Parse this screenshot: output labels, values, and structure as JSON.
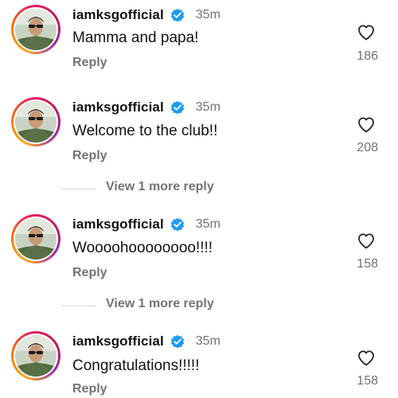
{
  "comments": [
    {
      "username": "iamksgofficial",
      "time": "35m",
      "text": "Mamma and papa!",
      "reply_label": "Reply",
      "likes": "186"
    },
    {
      "username": "iamksgofficial",
      "time": "35m",
      "text": "Welcome to the club!!",
      "reply_label": "Reply",
      "likes": "208"
    },
    {
      "username": "iamksgofficial",
      "time": "35m",
      "text": "Woooohoooooooo!!!!",
      "reply_label": "Reply",
      "likes": "158"
    },
    {
      "username": "iamksgofficial",
      "time": "35m",
      "text": "Congratulations!!!!!",
      "reply_label": "Reply",
      "likes": "158"
    }
  ],
  "view_more_replies": [
    {
      "label": "View 1 more reply"
    },
    {
      "label": "View 1 more reply"
    }
  ],
  "icons": {
    "verified": "verified-badge-icon",
    "like": "heart-outline-icon"
  },
  "colors": {
    "verified": "#1d9bf0",
    "muted": "#737373",
    "text": "#111111"
  }
}
